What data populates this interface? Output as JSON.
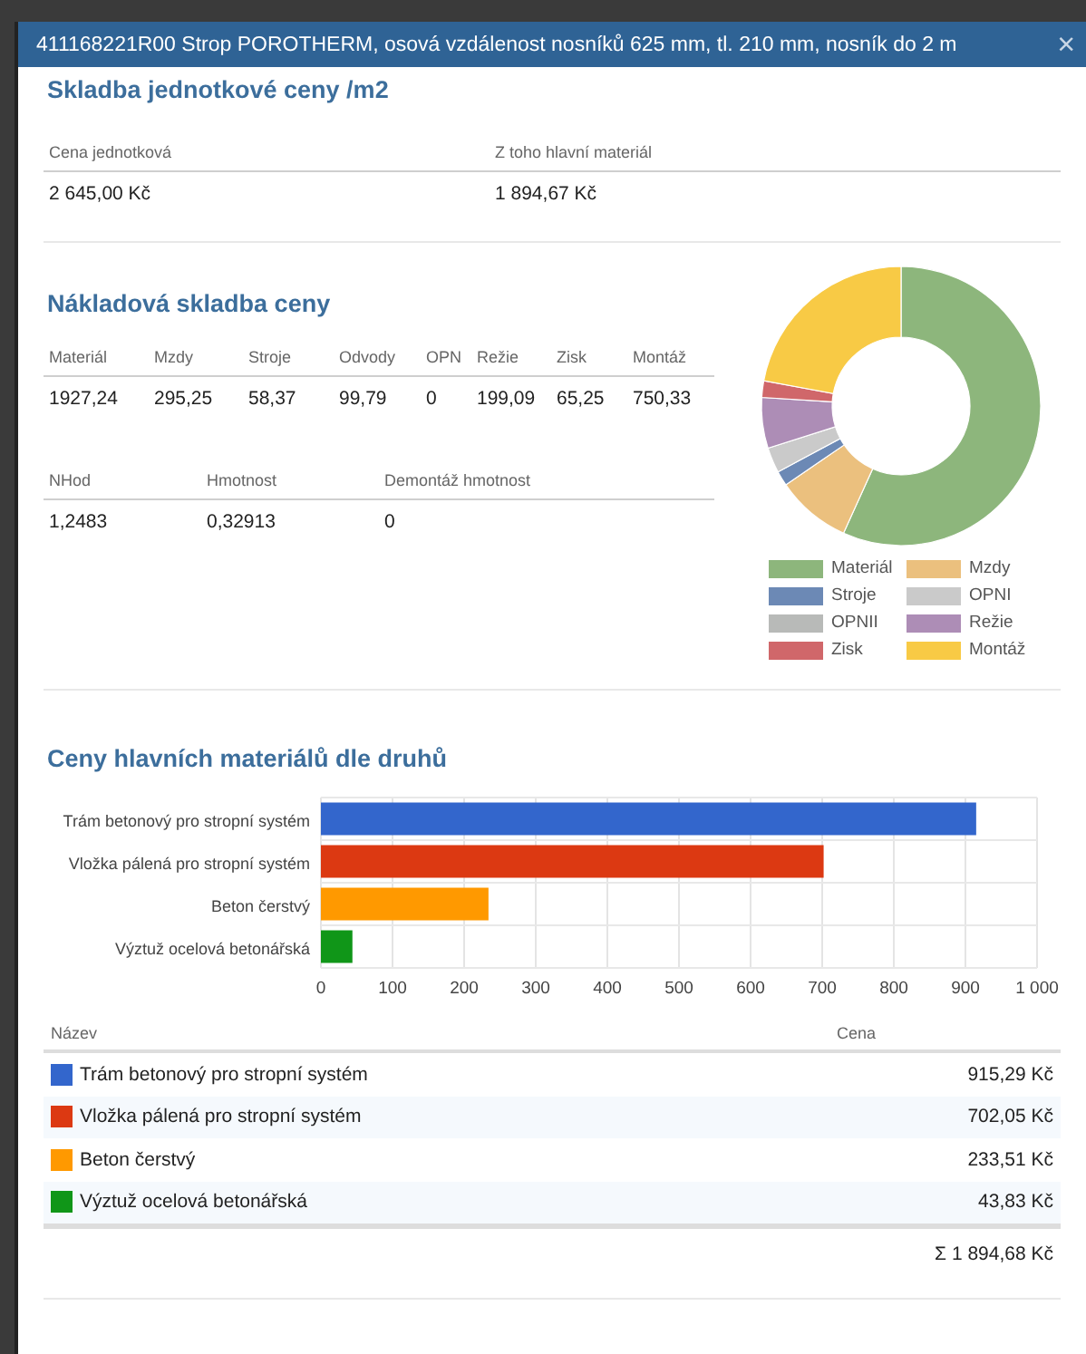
{
  "window": {
    "title": "411168221R00 Strop POROTHERM, osová vzdálenost nosníků 625 mm, tl. 210 mm, nosník do 2 m",
    "close": "×"
  },
  "unit_price": {
    "title": "Skladba jednotkové ceny /m2",
    "columns": [
      "Cena jednotková",
      "Z toho hlavní materiál"
    ],
    "values": [
      "2 645,00 Kč",
      "1 894,67 Kč"
    ]
  },
  "cost_structure": {
    "title": "Nákladová skladba ceny",
    "columns": [
      "Materiál",
      "Mzdy",
      "Stroje",
      "Odvody",
      "OPN",
      "Režie",
      "Zisk",
      "Montáž"
    ],
    "values": [
      "1927,24",
      "295,25",
      "58,37",
      "99,79",
      "0",
      "199,09",
      "65,25",
      "750,33"
    ],
    "columns_2": [
      "NHod",
      "Hmotnost",
      "Demontáž hmotnost"
    ],
    "values_2": [
      "1,2483",
      "0,32913",
      "0"
    ],
    "chart_data": {
      "type": "donut",
      "categories": [
        "Materiál",
        "Mzdy",
        "Stroje",
        "OPNI",
        "OPNII",
        "Režie",
        "Zisk",
        "Montáž"
      ],
      "series": [
        {
          "values": [
            56.76,
            8.7,
            1.72,
            2.94,
            0,
            5.86,
            1.92,
            22.1
          ]
        }
      ],
      "legend": "bottom",
      "colors": [
        "#8db67c",
        "#ebc07e",
        "#6c89b5",
        "#cacaca",
        "#b8bab8",
        "#ad8db6",
        "#d0676a",
        "#f8ca45"
      ]
    }
  },
  "materials": {
    "title": "Ceny hlavních materiálů dle druhů",
    "chart_data": {
      "type": "bar",
      "orientation": "horizontal",
      "categories": [
        "Trám betonový pro stropní systém",
        "Vložka pálená pro stropní systém",
        "Beton čerstvý",
        "Výztuž ocelová betonářská"
      ],
      "series": [
        {
          "values": [
            915,
            702,
            234,
            44
          ]
        }
      ],
      "grid": true,
      "xlim": [
        0,
        1000
      ],
      "xticks": [
        0,
        100,
        200,
        300,
        400,
        500,
        600,
        700,
        800,
        900,
        {
          "value": 1000,
          "label": "1 000"
        }
      ]
    },
    "table": {
      "columns": [
        "Název",
        "Cena"
      ],
      "rows": [
        {
          "name": "Trám betonový pro stropní systém",
          "price": "915,29 Kč",
          "color": "#3366cc"
        },
        {
          "name": "Vložka pálená pro stropní systém",
          "price": "702,05 Kč",
          "color": "#dc3912"
        },
        {
          "name": "Beton čerstvý",
          "price": "233,51 Kč",
          "color": "#ff9900"
        },
        {
          "name": "Výztuž ocelová betonářská",
          "price": "43,83 Kč",
          "color": "#109618"
        }
      ],
      "total": "Σ 1 894,68 Kč"
    }
  }
}
